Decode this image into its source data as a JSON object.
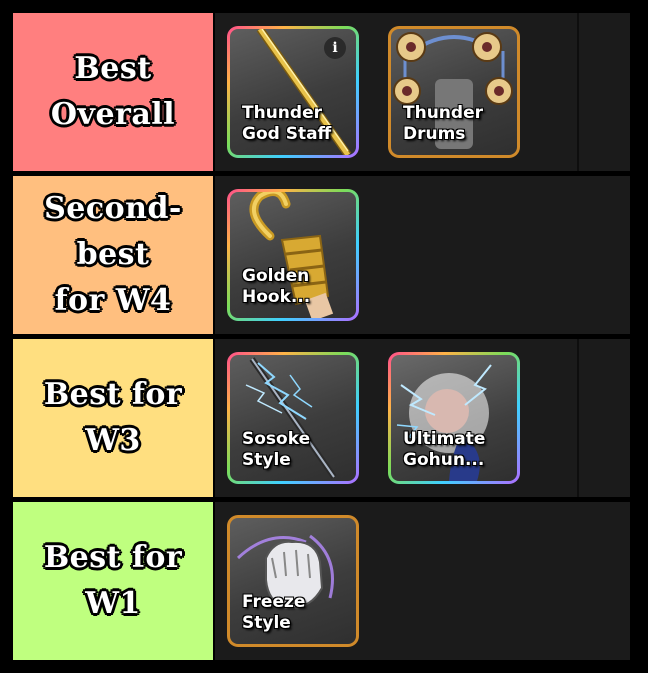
{
  "tiers": [
    {
      "label": "Best Overall",
      "color": "#ff7f7f",
      "items": [
        {
          "name": "Thunder\nGod Staff",
          "frame": "rainbow",
          "icon": "golden-staff-icon",
          "has_info": true,
          "info_symbol": "i"
        },
        {
          "name": "Thunder\nDrums",
          "frame": "gold",
          "icon": "thunder-drums-icon",
          "has_info": false
        }
      ]
    },
    {
      "label": "Second-best\nfor W4",
      "color": "#ffbf7f",
      "items": [
        {
          "name": "Golden\nHook...",
          "frame": "rainbow",
          "icon": "golden-hook-icon",
          "has_info": false
        }
      ]
    },
    {
      "label": "Best for W3",
      "color": "#ffdf80",
      "items": [
        {
          "name": "Sosoke\nStyle",
          "frame": "rainbow",
          "icon": "lightning-sword-icon",
          "has_info": false
        },
        {
          "name": "Ultimate\nGohun...",
          "frame": "rainbow",
          "icon": "lightning-fist-icon",
          "has_info": false
        }
      ]
    },
    {
      "label": "Best for W1",
      "color": "#bfff7f",
      "items": [
        {
          "name": "Freeze\nStyle",
          "frame": "gold",
          "icon": "freeze-fist-icon",
          "has_info": false
        }
      ]
    }
  ]
}
